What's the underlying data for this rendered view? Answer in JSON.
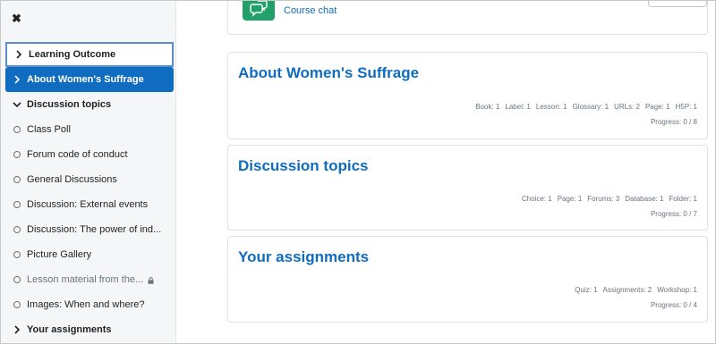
{
  "sidebar": {
    "items": [
      {
        "label": "Learning Outcome",
        "kind": "section",
        "state": "focused"
      },
      {
        "label": "About Women's Suffrage",
        "kind": "section",
        "state": "active"
      },
      {
        "label": "Discussion topics",
        "kind": "section-open",
        "state": ""
      },
      {
        "label": "Class Poll",
        "kind": "activity",
        "state": ""
      },
      {
        "label": "Forum code of conduct",
        "kind": "activity",
        "state": ""
      },
      {
        "label": "General Discussions",
        "kind": "activity",
        "state": ""
      },
      {
        "label": "Discussion: External events",
        "kind": "activity",
        "state": ""
      },
      {
        "label": "Discussion: The power of ind...",
        "kind": "activity",
        "state": ""
      },
      {
        "label": "Picture Gallery",
        "kind": "activity",
        "state": ""
      },
      {
        "label": "Lesson material from the...",
        "kind": "activity-locked",
        "state": "dim"
      },
      {
        "label": "Images: When and where?",
        "kind": "activity",
        "state": ""
      },
      {
        "label": "Your assignments",
        "kind": "section",
        "state": ""
      }
    ]
  },
  "top_card": {
    "chat_label": "Course chat"
  },
  "sections": [
    {
      "title": "About Women's Suffrage",
      "counts": [
        "Book: 1",
        "Label: 1",
        "Lesson: 1",
        "Glossary: 1",
        "URLs: 2",
        "Page: 1",
        "H5P: 1"
      ],
      "progress": "Progress: 0 / 8"
    },
    {
      "title": "Discussion topics",
      "counts": [
        "Choice: 1",
        "Page: 1",
        "Forums: 3",
        "Database: 1",
        "Folder: 1"
      ],
      "progress": "Progress: 0 / 7"
    },
    {
      "title": "Your assignments",
      "counts": [
        "Quiz: 1",
        "Assignments: 2",
        "Workshop: 1"
      ],
      "progress": "Progress: 0 / 4"
    }
  ],
  "colors": {
    "accent": "#0f6cbf",
    "chat": "#21a06a",
    "focus": "#5a8ed1"
  }
}
